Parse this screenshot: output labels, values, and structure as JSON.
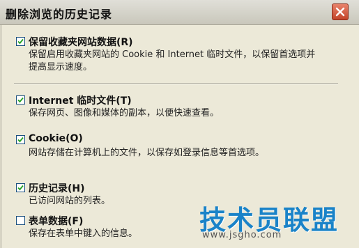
{
  "window": {
    "title": "删除浏览的历史记录"
  },
  "options": [
    {
      "label": "保留收藏夹网站数据(R)",
      "checked": true,
      "description": "保留启用收藏夹网站的 Cookie 和 Internet 临时文件，以保留首选项并提高显示速度。"
    },
    {
      "label": "Internet 临时文件(T)",
      "checked": true,
      "description": "保存网页、图像和媒体的副本，以便快速查看。"
    },
    {
      "label": "Cookie(O)",
      "checked": true,
      "description": "网站存储在计算机上的文件，以保存如登录信息等首选项。"
    },
    {
      "label": "历史记录(H)",
      "checked": true,
      "description": "已访问网站的列表。"
    },
    {
      "label": "表单数据(F)",
      "checked": false,
      "description": "保存在表单中键入的信息。"
    }
  ],
  "watermark": {
    "text": "技术员联盟",
    "url": "www.jsgho.com"
  },
  "icons": {
    "close": "close-icon",
    "check": "checkmark-icon"
  },
  "colors": {
    "dialog_bg": "#ece9d8",
    "close_button": "#c3452a",
    "checkmark": "#21a121",
    "watermark": "#1a83c8"
  }
}
